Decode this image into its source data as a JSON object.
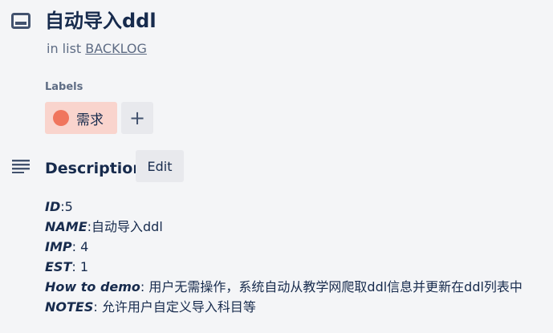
{
  "card": {
    "title": "自动导入ddl",
    "in_list_prefix": "in list ",
    "list_name": "BACKLOG"
  },
  "labels": {
    "heading": "Labels",
    "items": [
      {
        "name": "需求",
        "color": "#f0755d",
        "background": "#f9d4cd"
      }
    ],
    "add_label": "+"
  },
  "description": {
    "heading": "Description",
    "edit_label": "Edit",
    "lines": [
      {
        "key": "ID",
        "sep": ":",
        "value": "5"
      },
      {
        "key": "NAME",
        "sep": ":",
        "value": "自动导入ddl"
      },
      {
        "key": "IMP",
        "sep": ": ",
        "value": "4"
      },
      {
        "key": "EST",
        "sep": ": ",
        "value": "1"
      },
      {
        "key": "How to demo",
        "sep": ": ",
        "value": "用户无需操作，系统自动从教学网爬取ddl信息并更新在ddl列表中"
      },
      {
        "key": "NOTES",
        "sep": ": ",
        "value": "允许用户自定义导入科目等"
      }
    ]
  },
  "icons": {
    "card": "card-icon",
    "description": "description-lines-icon"
  }
}
